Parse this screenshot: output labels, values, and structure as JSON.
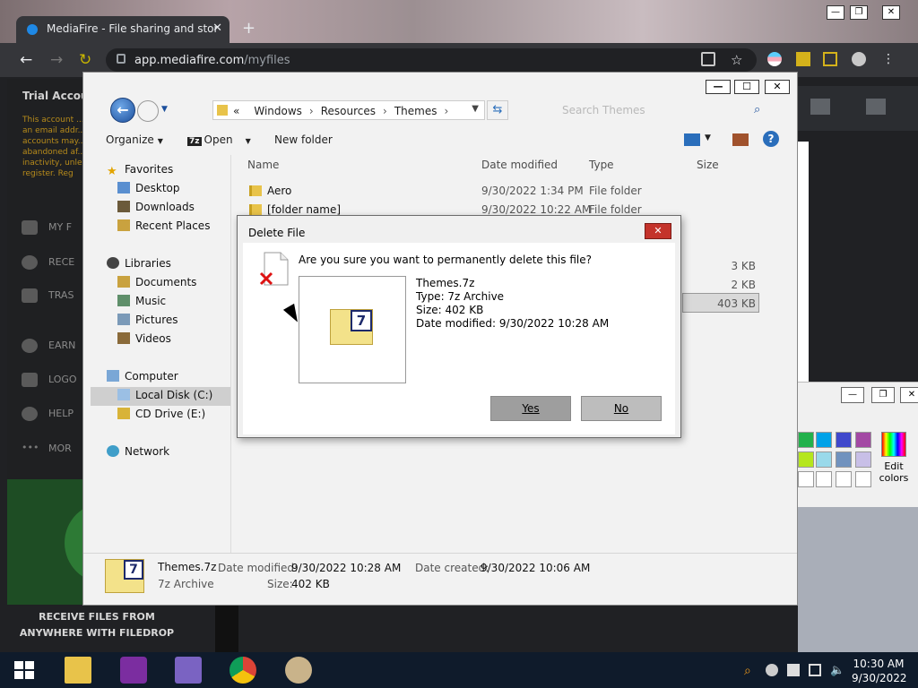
{
  "browser": {
    "tab_title": "MediaFire - File sharing and stor",
    "url_host": "app.mediafire.com",
    "url_path": "/myfiles"
  },
  "mediafire": {
    "trial": "Trial Accou",
    "note": "This account ... an email addr... accounts may... abandoned af... inactivity, unle... register. Reg",
    "items": [
      "MY F",
      "RECE",
      "TRAS",
      "EARN",
      "LOGO",
      "HELP",
      "MOR"
    ],
    "promo": "RECEIVE FILES FROM ANYWHERE WITH FILEDROP"
  },
  "explorer": {
    "path": [
      "Windows",
      "Resources",
      "Themes"
    ],
    "search_placeholder": "Search Themes",
    "commands": {
      "organize": "Organize",
      "open": "Open",
      "new_folder": "New folder"
    },
    "nav": {
      "favorites": "Favorites",
      "desktop": "Desktop",
      "downloads": "Downloads",
      "recent": "Recent Places",
      "libraries": "Libraries",
      "documents": "Documents",
      "music": "Music",
      "pictures": "Pictures",
      "videos": "Videos",
      "computer": "Computer",
      "local_disk": "Local Disk (C:)",
      "cd_drive": "CD Drive (E:)",
      "network": "Network"
    },
    "columns": {
      "name": "Name",
      "date": "Date modified",
      "type": "Type",
      "size": "Size"
    },
    "rows": [
      {
        "name": "Aero",
        "date": "9/30/2022 1:34 PM",
        "type": "File folder"
      },
      {
        "name": "[folder name]",
        "date": "9/30/2022 10:22 AM",
        "type": "File folder"
      }
    ],
    "sizes": [
      "3 KB",
      "2 KB",
      "403 KB"
    ],
    "status": {
      "filename": "Themes.7z",
      "filetype": "7z Archive",
      "modified_label": "Date modified:",
      "modified": "9/30/2022 10:28 AM",
      "created_label": "Date created:",
      "created": "9/30/2022 10:06 AM",
      "size_label": "Size:",
      "size": "402 KB"
    }
  },
  "dialog": {
    "title": "Delete File",
    "question": "Are you sure you want to permanently delete this file?",
    "file_name": "Themes.7z",
    "file_type": "Type: 7z Archive",
    "file_size": "Size: 402 KB",
    "file_date": "Date modified: 9/30/2022 10:28 AM",
    "yes": "Yes",
    "no": "No",
    "close": "✕"
  },
  "paint": {
    "edit_colors": "Edit colors"
  },
  "taskbar": {
    "time": "10:30 AM",
    "date": "9/30/2022"
  },
  "colors": {
    "dialog_close": "#c4332b",
    "selection": "#cfcfcf",
    "taskbar": "#0f1b2b"
  }
}
